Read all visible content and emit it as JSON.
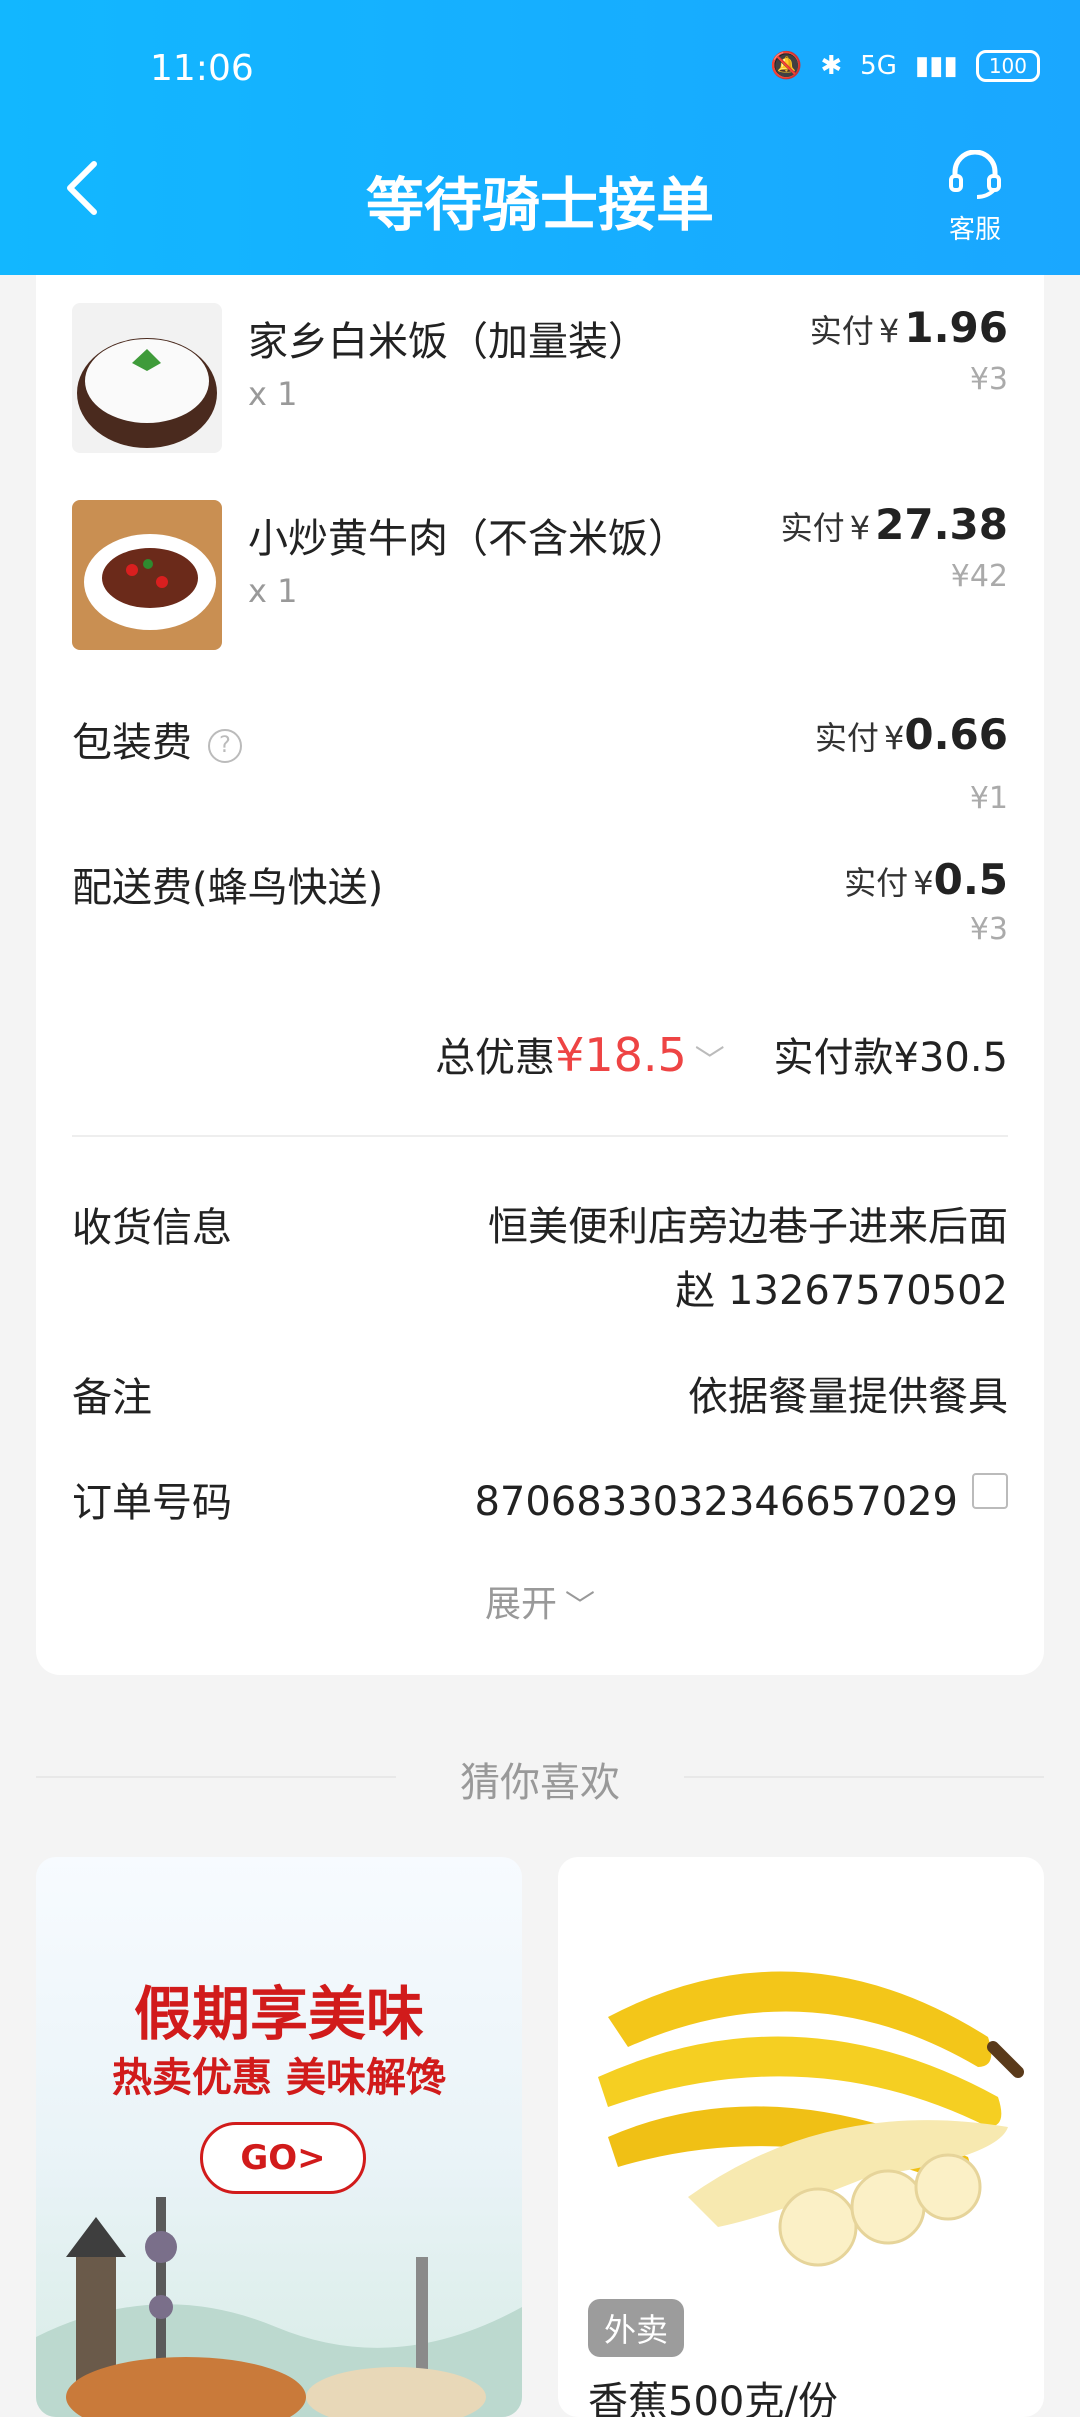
{
  "status": {
    "time": "11:06",
    "battery": "100",
    "network": "5G"
  },
  "header": {
    "title": "等待骑士接单",
    "service_label": "客服"
  },
  "items": [
    {
      "name": "家乡白米饭（加量装）",
      "qty": "x 1",
      "pay_label": "实付",
      "currency": "¥",
      "pay": "1.96",
      "orig": "¥3"
    },
    {
      "name": "小炒黄牛肉（不含米饭）",
      "qty": "x 1",
      "pay_label": "实付",
      "currency": "¥",
      "pay": "27.38",
      "orig": "¥42"
    }
  ],
  "fees": [
    {
      "name": "包装费",
      "pay_label": "实付",
      "currency": "¥",
      "pay": "0.66",
      "orig": "¥1"
    },
    {
      "name": "配送费(蜂鸟快送)",
      "pay_label": "实付",
      "currency": "¥",
      "pay": "0.5",
      "orig": "¥3"
    }
  ],
  "totals": {
    "discount_label": "总优惠",
    "discount_currency": "¥",
    "discount": "18.5",
    "paid_label": "实付款",
    "paid_currency": "¥",
    "paid": "30.5"
  },
  "info": {
    "address_label": "收货信息",
    "address_line1": "恒美便利店旁边巷子进来后面",
    "address_line2": "赵 13267570502",
    "note_label": "备注",
    "note_value": "依据餐量提供餐具",
    "order_label": "订单号码",
    "order_value": "8706833032346657029"
  },
  "expand_label": "展开",
  "recommend": {
    "title": "猜你喜欢",
    "promo": {
      "title": "假期享美味",
      "subtitle": "热卖优惠 美味解馋",
      "button": "GO>"
    },
    "product": {
      "badge": "外卖",
      "name": "香蕉500克/份"
    }
  },
  "colors": {
    "header": "#1aa7ff",
    "discount": "#ee4444",
    "promo": "#d11b1b"
  }
}
